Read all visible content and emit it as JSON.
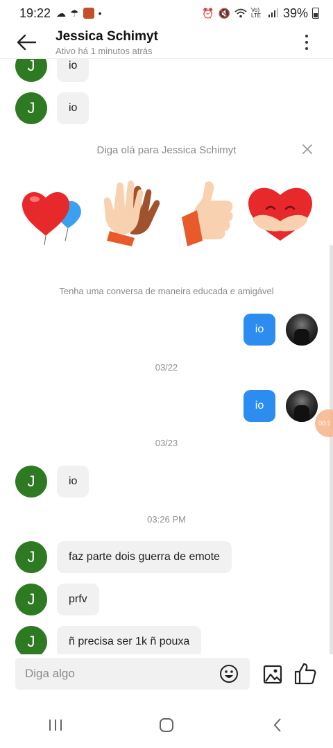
{
  "status": {
    "time": "19:22",
    "network": "Vo) LTE",
    "battery": "39%"
  },
  "header": {
    "title": "Jessica Schimyt",
    "subtitle": "Ativo há 1 minutos atrás"
  },
  "messages": {
    "m1": "io",
    "m2": "io",
    "m3": "io",
    "m4": "io",
    "m5": "io",
    "m6": "faz parte dois guerra de emote",
    "m7": "prfv",
    "m8": "ñ precisa ser 1k ñ pouxa"
  },
  "contact_initial": "J",
  "greeting": {
    "text": "Diga olá para Jessica Schimyt",
    "hint": "Tenha uma conversa de maneira educada e amigável",
    "stickers": [
      "heart-balloon-icon",
      "high-five-icon",
      "thumbs-up-icon",
      "heart-hug-icon"
    ]
  },
  "dates": {
    "d1": "03/22",
    "d2": "03/23",
    "d3": "03:26 PM"
  },
  "float_bubble": "00:1",
  "composer": {
    "placeholder": "Diga algo"
  },
  "colors": {
    "accent": "#2d8cf0",
    "avatar_green": "#2e7a23",
    "bubble_in": "#f1f1f1"
  }
}
